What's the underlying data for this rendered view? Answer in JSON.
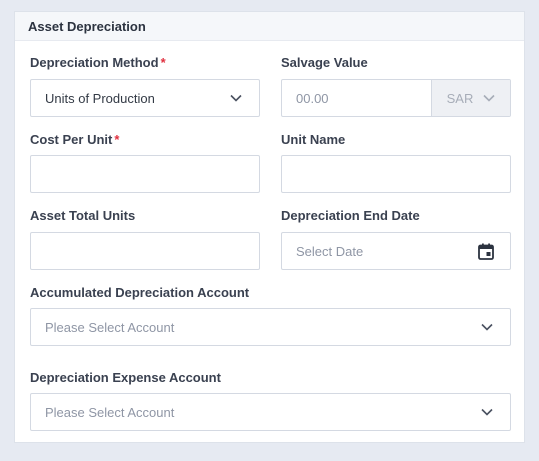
{
  "card": {
    "title": "Asset Depreciation"
  },
  "fields": {
    "method": {
      "label": "Depreciation Method",
      "required_mark": "*",
      "value": "Units of Production",
      "icon": "chevron-down-icon"
    },
    "salvage": {
      "label": "Salvage Value",
      "placeholder": "00.00",
      "currency": "SAR",
      "icon": "chevron-down-icon"
    },
    "cost_per_unit": {
      "label": "Cost Per Unit",
      "required_mark": "*",
      "value": ""
    },
    "unit_name": {
      "label": "Unit Name",
      "value": ""
    },
    "total_units": {
      "label": "Asset Total Units",
      "value": ""
    },
    "end_date": {
      "label": "Depreciation End Date",
      "placeholder": "Select Date",
      "icon": "calendar-icon"
    },
    "accumulated_account": {
      "label": "Accumulated Depreciation Account",
      "placeholder": "Please Select Account",
      "icon": "chevron-down-icon"
    },
    "expense_account": {
      "label": "Depreciation Expense Account",
      "placeholder": "Please Select Account",
      "icon": "chevron-down-icon"
    }
  },
  "colors": {
    "background": "#e6eaf2",
    "required": "#e0303f",
    "border": "#d4d9e2",
    "suffix_bg": "#eef0f4"
  }
}
